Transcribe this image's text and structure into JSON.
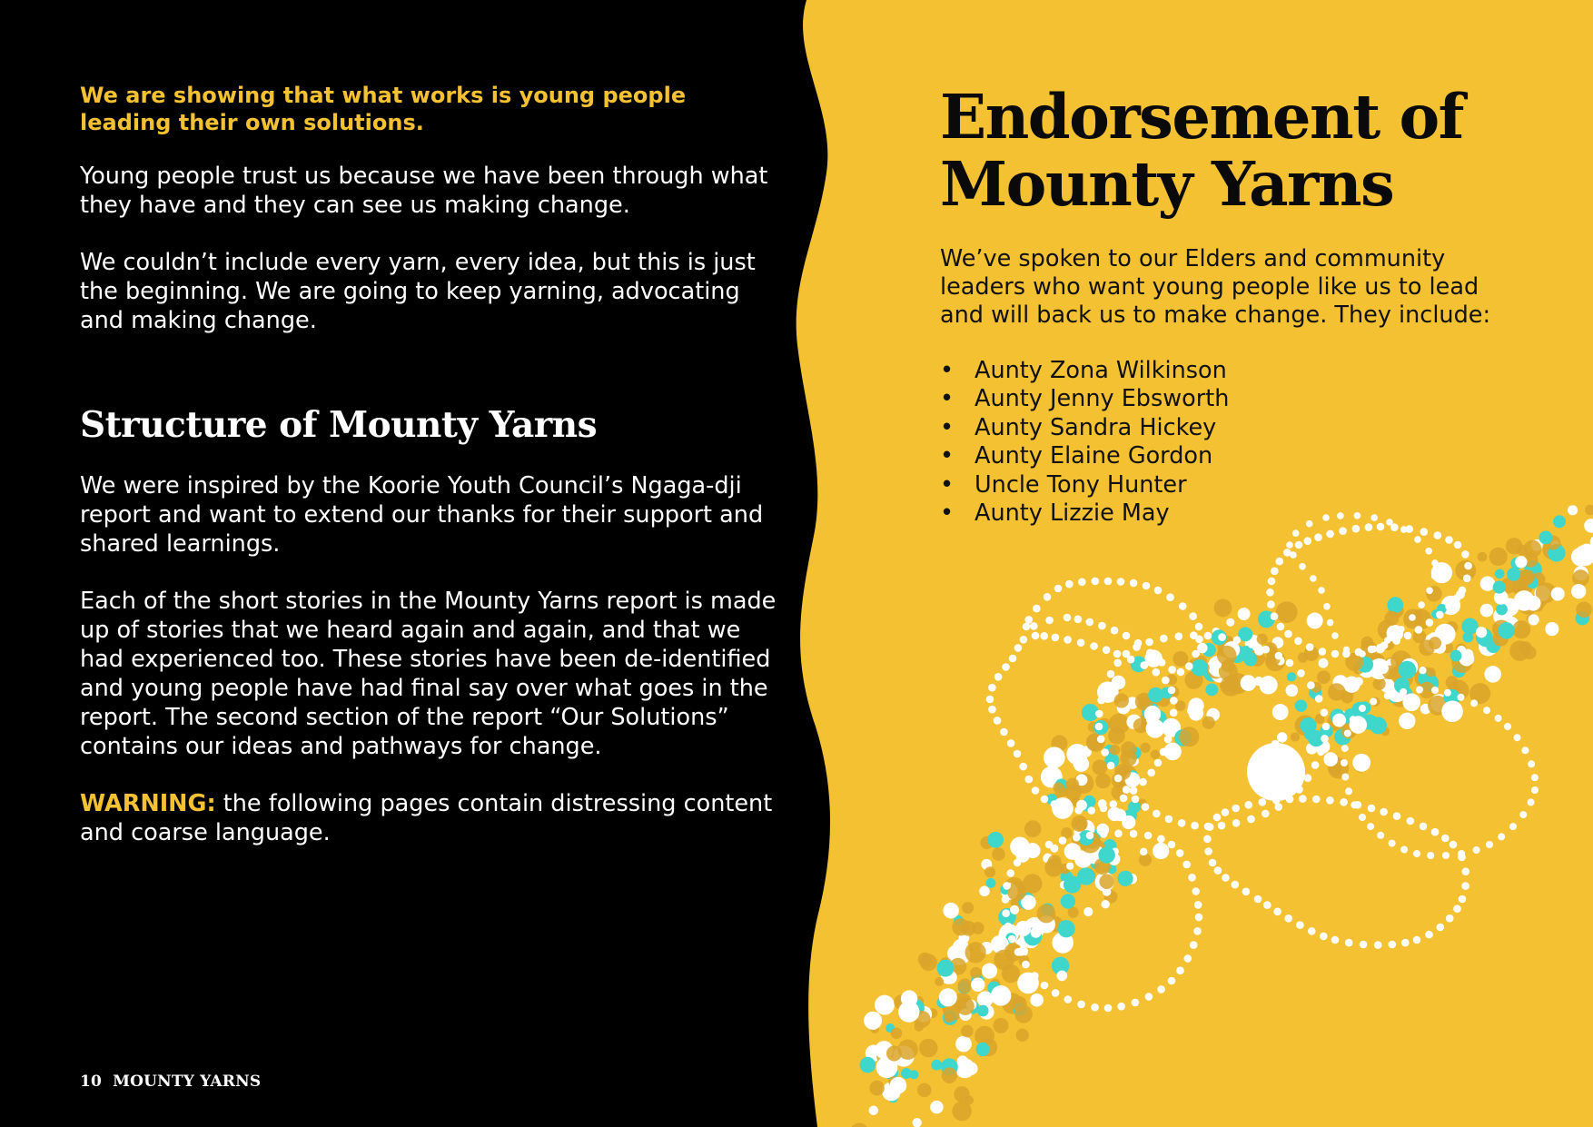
{
  "colors": {
    "background_dark": "#000000",
    "panel_yellow": "#f4c133",
    "accent_yellow": "#f4c133",
    "dot_white": "#ffffff",
    "dot_teal": "#3fd6cc",
    "dot_ochre": "#d9a52a"
  },
  "left": {
    "lead": "We are showing that what works is young people leading their own solutions.",
    "para1": "Young people trust us because we have been through what they have and they can see us making change.",
    "para2": "We couldn’t include every yarn, every idea, but this is just the beginning. We are going to keep yarning, advocating and making change.",
    "structure_heading": "Structure of Mounty Yarns",
    "para3": "We were inspired by the Koorie Youth Council’s Ngaga-dji report and want to extend our thanks for their support and shared learnings.",
    "para4": "Each of the short stories in the Mounty Yarns report is made up of stories that we heard again and again, and that we had experienced too. These stories have been de-identified and young people have had final say over what goes in the report. The second section of the report “Our Solutions” contains our ideas and pathways for change.",
    "warning_label": "WARNING:",
    "warning_text": " the following pages contain distressing content and coarse language."
  },
  "right": {
    "title": "Endorsement of Mounty Yarns",
    "intro": "We’ve spoken to our Elders and community leaders who want young people like us to lead and will back us to make change. They include:",
    "bullet": "•",
    "elders": [
      "Aunty Zona Wilkinson",
      "Aunty Jenny Ebsworth",
      "Aunty Sandra Hickey",
      "Aunty Elaine Gordon",
      "Uncle Tony Hunter",
      "Aunty Lizzie May"
    ]
  },
  "footer": {
    "page_number": "10",
    "publication": "MOUNTY YARNS"
  },
  "artwork": {
    "icon": "dot-painting-artwork"
  }
}
